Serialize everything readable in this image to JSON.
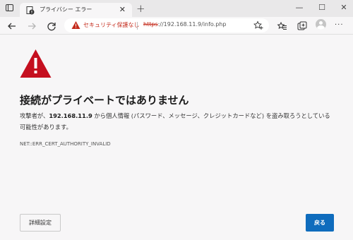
{
  "tab": {
    "title": "プライバシー エラー",
    "close_glyph": "✕"
  },
  "tabstrip": {
    "new_tab_glyph": "+",
    "minimize_glyph": "—",
    "maximize_glyph": "☐",
    "close_glyph": "✕"
  },
  "toolbar": {
    "more_glyph": "···"
  },
  "addressbar": {
    "security_label": "セキュリティ保護なし",
    "url_scheme": "https",
    "url_rest": "://192.168.11.9/info.php"
  },
  "page": {
    "title": "接続がプライベートではありません",
    "body_prefix": "攻撃者が、",
    "host": "192.168.11.9",
    "body_suffix": " から個人情報 (パスワード、メッセージ、クレジットカードなど) を盗み取ろうとしている可能性があります。",
    "error_code": "NET::ERR_CERT_AUTHORITY_INVALID"
  },
  "buttons": {
    "advanced": "詳細設定",
    "back": "戻る"
  },
  "icons": {
    "warning": "warning-triangle-icon",
    "back": "back-arrow-icon",
    "forward": "forward-arrow-icon",
    "refresh": "refresh-icon",
    "favorites_add": "add-favorite-icon",
    "favorites": "favorites-icon",
    "collections": "collections-icon",
    "profile": "profile-icon"
  },
  "colors": {
    "accent": "#0f6cbd",
    "warning_red": "#c42b1c",
    "triangle_red": "#c50f1f"
  }
}
